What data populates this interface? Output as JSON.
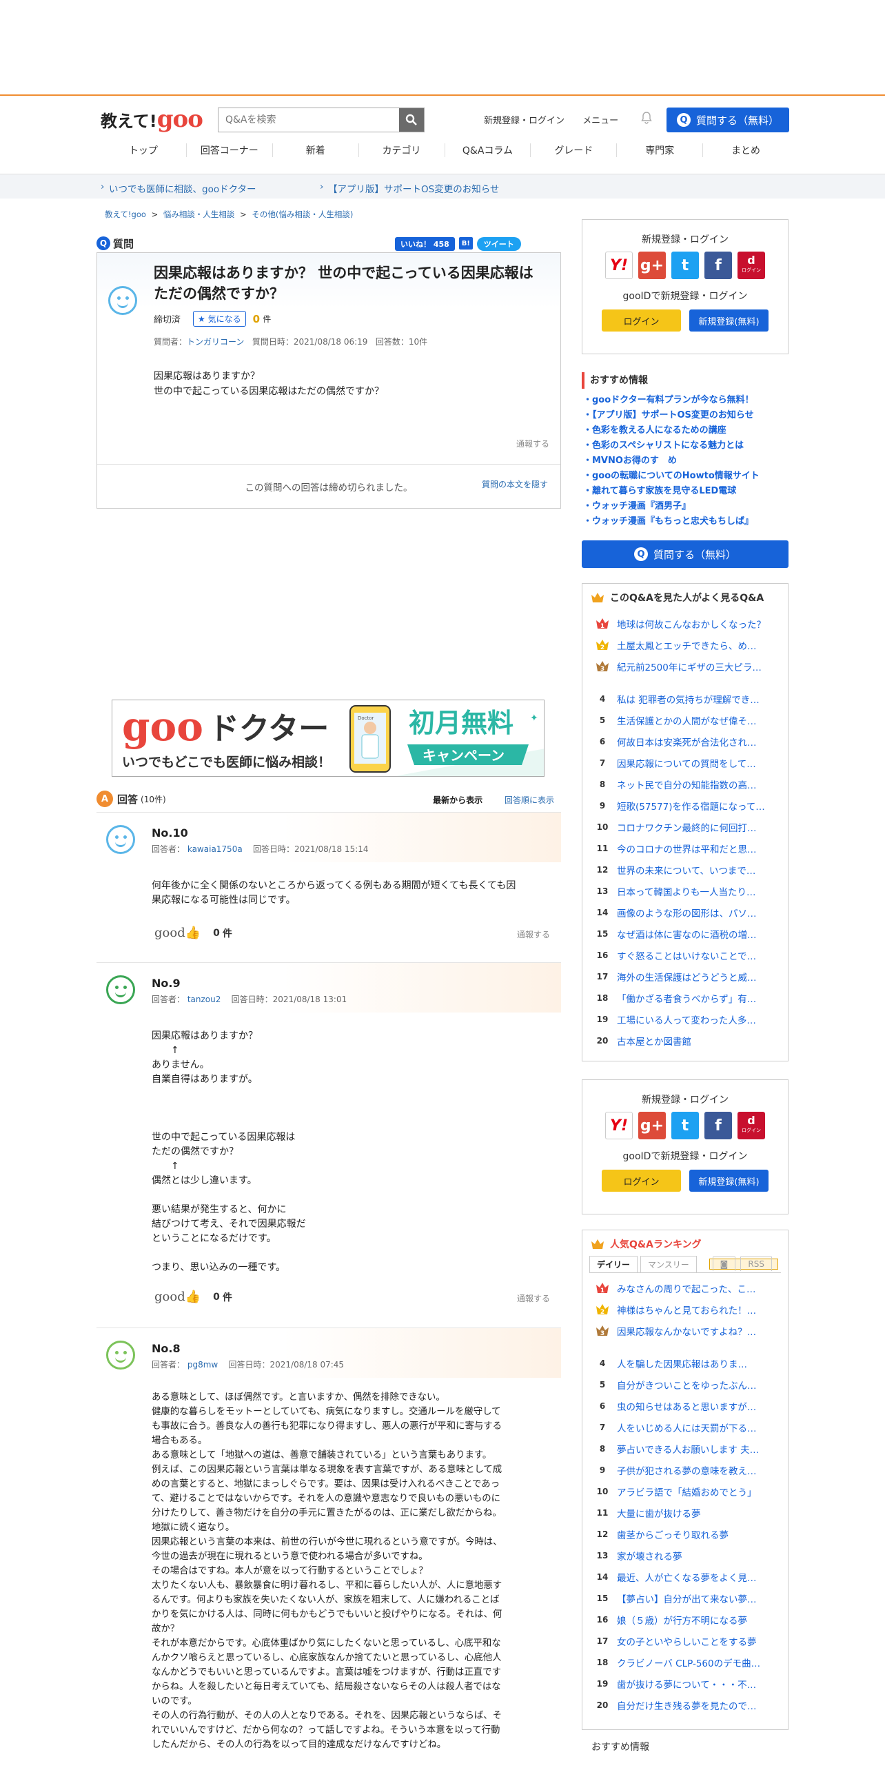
{
  "header": {
    "logo_text": "教えて!",
    "logo_goo": "goo",
    "search_placeholder": "Q&Aを検索",
    "register_login": "新規登録・ログイン",
    "menu": "メニュー",
    "ask_button": "質問する（無料）"
  },
  "nav": [
    "トップ",
    "回答コーナー",
    "新着",
    "カテゴリ",
    "Q&Aコラム",
    "グレード",
    "専門家",
    "まとめ"
  ],
  "notices": [
    "いつでも医師に相談、gooドクター",
    "【アプリ版】サポートOS変更のお知らせ"
  ],
  "breadcrumb": [
    "教えて!goo",
    ">",
    "悩み相談・人生相談",
    ">",
    "その他(悩み相談・人生相談)"
  ],
  "question": {
    "section_label": "質問",
    "like_label": "いいね！ 458",
    "hatena": "B!",
    "tweet": "ツイート",
    "title": "因果応報はありますか？ 世の中で起こっている因果応報はただの偶然ですか？",
    "status": "締切済",
    "watch": "気になる",
    "watch_count": "0",
    "watch_unit": "件",
    "meta_asker_label": "質問者：",
    "meta_asker": "トンガリコーン",
    "meta_date": "質問日時：2021/08/18 06:19",
    "meta_answers": "回答数：10件",
    "body_line1": "因果応報はありますか？",
    "body_line2": "世の中で起こっている因果応報はただの偶然ですか？",
    "report": "通報する",
    "closed_msg": "この質問への回答は締め切られました。",
    "hide_body": "質問の本文を隠す"
  },
  "banner": {
    "goo": "goo",
    "doctor": "ドクター",
    "tagline": "いつでもどこでも医師に悩み相談！",
    "promo": "初月無料",
    "campaign": "キャンペーン",
    "phone_label": "Doctor"
  },
  "answers_head": {
    "label": "回答",
    "count": "(10件)",
    "newest": "最新から表示",
    "oldest": "回答順に表示"
  },
  "answers": [
    {
      "no": "No.10",
      "user_label": "回答者：",
      "user": "kawaia1750a",
      "date": "回答日時：2021/08/18 15:14",
      "body": "何年後かに全く関係のないところから返ってくる例もある期間が短くても長くても因\n果応報になる可能性は同じです。",
      "good": "good",
      "good_count": "0",
      "good_unit": "件",
      "report": "通報する"
    },
    {
      "no": "No.9",
      "user_label": "回答者：",
      "user": "tanzou2",
      "date": "回答日時：2021/08/18 13:01",
      "body": "因果応報はありますか？\n　　↑\nありません。\n自業自得はありますが。\n\n\n\n世の中で起こっている因果応報は\nただの偶然ですか？\n　　↑\n偶然とは少し違います。\n\n悪い結果が発生すると、何かに\n結びつけて考え、それで因果応報だ\nということになるだけです。\n\nつまり、思い込みの一種です。",
      "good": "good",
      "good_count": "0",
      "good_unit": "件",
      "report": "通報する"
    },
    {
      "no": "No.8",
      "user_label": "回答者：",
      "user": "pg8mw",
      "date": "回答日時：2021/08/18 07:45",
      "body": "ある意味として、ほぼ偶然です。と言いますか、偶然を排除できない。\n健康的な暮らしをモットーとしていても、病気になりますし。交通ルールを厳守して\nも事故に合う。善良な人の善行も犯罪になり得ますし、悪人の悪行が平和に寄与する\n場合もある。\nある意味として「地獄への道は、善意で舗装されている」という言葉もあります。\n例えば、この因果応報という言葉は単なる現象を表す言葉ですが、ある意味として成\nめの言葉とすると、地獄にまっしぐらです。要は、因果は受け入れるべきことであっ\nて、避けることではないからです。それを人の意識や意志なりで良いもの悪いものに\n分けたりして、善き物だけを自分の手元に置きたがるのは、正に業だし欲だからね。\n地獄に続く道なり。\n因果応報という言葉の本来は、前世の行いが今世に現れるという意ですが。今時は、\n今世の過去が現在に現れるという意で使われる場合が多いですね。\nその場合はですね。本人が意を以って行動するということでしょ？\n太りたくない人も、暴飲暴食に明け暮れるし、平和に暮らしたい人が、人に意地悪す\nるんです。何よりも家族を失いたくない人が、家族を粗末して、人に嫌われることば\nかりを気にかける人は、同時に何もかもどうでもいいと投げやりになる。それは、何\n故か？\nそれが本意だからです。心底体重ばかり気にしたくないと思っているし、心底平和な\nんかクソ喰らえと思っているし、心底家族なんか捨てたいと思っているし、心底他人\nなんかどうでもいいと思っているんですよ。言葉は嘘をつけますが、行動は正直です\nからね。人を殺したいと毎日考えていても、結局殺さないならその人は殺人者ではな\nいのです。\nその人の行為行動が、その人の人となりである。それを、因果応報というならば、そ\nれでいいんですけど、だから何なの？って話しですよね。そういう本意を以って行動\nしたんだから、その人の行為を以って目的達成なだけなんですけどね。"
    }
  ],
  "sidebar": {
    "login_title": "新規登録・ログイン",
    "sns": [
      "Y!",
      "g+",
      "t",
      "f",
      "d"
    ],
    "sns_docomo_label": "ログイン",
    "gooid_register": "gooIDで新規登録・ログイン",
    "login_btn": "ログイン",
    "register_btn": "新規登録(無料)",
    "recommend_title": "おすすめ情報",
    "recommend": [
      "・gooドクター有料プランが今なら無料！",
      "・【アプリ版】サポートOS変更のお知らせ",
      "・色彩を教える人になるための講座",
      "・色彩のスペシャリストになる魅力とは",
      "・MVNOお得のす　め",
      "・gooの転職についてのHowto情報サイト",
      "・離れて暮らす家族を見守るLED電球",
      "・ウォッチ漫画『酒男子』",
      "・ウォッチ漫画『もちっと忠犬もちしば』"
    ],
    "ask_button": "質問する（無料）",
    "also_viewed_title": "このQ&Aを見た人がよく見るQ&A",
    "also_viewed": [
      {
        "rank": "1",
        "title": "地球は何故こんなおかしくなった？"
      },
      {
        "rank": "2",
        "title": "土屋太鳳とエッチできたら、め…"
      },
      {
        "rank": "3",
        "title": "紀元前2500年にギザの三大ピラ…"
      },
      {
        "rank": "4",
        "title": "私は 犯罪者の気持ちが理解でき…"
      },
      {
        "rank": "5",
        "title": "生活保護とかの人間がなぜ偉そ…"
      },
      {
        "rank": "6",
        "title": "何故日本は安楽死が合法化され…"
      },
      {
        "rank": "7",
        "title": "因果応報についての質問をして…"
      },
      {
        "rank": "8",
        "title": "ネット民で自分の知能指数の高…"
      },
      {
        "rank": "9",
        "title": "短歌(57577)を作る宿題になって…"
      },
      {
        "rank": "10",
        "title": "コロナワクチン最終的に何回打…"
      },
      {
        "rank": "11",
        "title": "今のコロナの世界は平和だと思…"
      },
      {
        "rank": "12",
        "title": "世界の未来について、いつまで…"
      },
      {
        "rank": "13",
        "title": "日本って韓国よりも一人当たり…"
      },
      {
        "rank": "14",
        "title": "画像のような形の図形は、パソ…"
      },
      {
        "rank": "15",
        "title": "なぜ酒は体に害なのに酒税の増…"
      },
      {
        "rank": "16",
        "title": "すぐ怒ることはいけないことで…"
      },
      {
        "rank": "17",
        "title": "海外の生活保護はどうどうと威…"
      },
      {
        "rank": "18",
        "title": "「働かざる者食うべからず」有…"
      },
      {
        "rank": "19",
        "title": "工場にいる人って変わった人多…"
      },
      {
        "rank": "20",
        "title": "古本屋とか図書館"
      }
    ],
    "ranking_title": "人気Q&Aランキング",
    "ranking_tab_daily": "デイリー",
    "ranking_tab_monthly": "マンスリー",
    "rss": "RSS",
    "ranking": [
      {
        "rank": "1",
        "title": "みなさんの周りで起こった、こ…"
      },
      {
        "rank": "2",
        "title": "神様はちゃんと見ておられた！…"
      },
      {
        "rank": "3",
        "title": "因果応報なんかないですよね？…"
      },
      {
        "rank": "4",
        "title": "人を騙した因果応報はありま…"
      },
      {
        "rank": "5",
        "title": "自分がきついことをゆったぶん…"
      },
      {
        "rank": "6",
        "title": "虫の知らせはあると思いますが…"
      },
      {
        "rank": "7",
        "title": "人をいじめる人には天罰が下る…"
      },
      {
        "rank": "8",
        "title": "夢占いできる人お願いします 夫…"
      },
      {
        "rank": "9",
        "title": "子供が犯される夢の意味を教え…"
      },
      {
        "rank": "10",
        "title": "アラビラ語で「結婚おめでとう」"
      },
      {
        "rank": "11",
        "title": "大量に歯が抜ける夢"
      },
      {
        "rank": "12",
        "title": "歯茎からごっそり取れる夢"
      },
      {
        "rank": "13",
        "title": "家が壊される夢"
      },
      {
        "rank": "14",
        "title": "最近、人が亡くなる夢をよく見…"
      },
      {
        "rank": "15",
        "title": "【夢占い】自分が出て来ない夢…"
      },
      {
        "rank": "16",
        "title": "娘（５歳）が行方不明になる夢"
      },
      {
        "rank": "17",
        "title": "女の子といやらしいことをする夢"
      },
      {
        "rank": "18",
        "title": "クラビノーバ CLP-560のデモ曲…"
      },
      {
        "rank": "19",
        "title": "歯が抜ける夢について・・・不…"
      },
      {
        "rank": "20",
        "title": "自分だけ生き残る夢を見たので…"
      }
    ],
    "recommend_bottom": "おすすめ情報"
  },
  "colors": {
    "accent": "#f08c30",
    "brand_blue": "#1763d9",
    "goo_red": "#e8453c",
    "login_yellow": "#f5c518"
  }
}
